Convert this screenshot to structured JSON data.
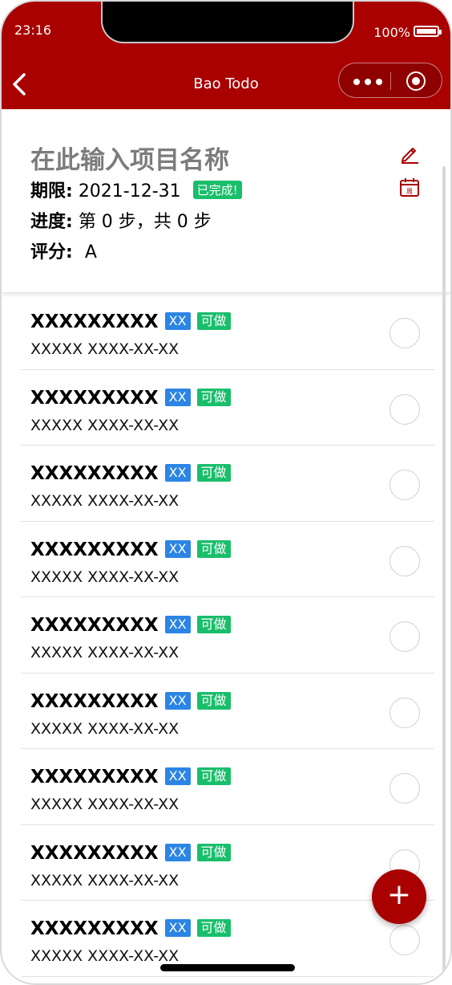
{
  "status": {
    "time": "23:16",
    "battery": "100%"
  },
  "nav": {
    "title": "Bao Todo"
  },
  "project": {
    "name": "在此输入项目名称",
    "deadline_label": "期限:",
    "deadline_value": "2021-12-31",
    "done_badge": "已完成!",
    "progress_label": "进度:",
    "progress_value": "第 0 步，共 0 步",
    "score_label": "评分:",
    "score_value": "A",
    "calendar_glyph": "周"
  },
  "tasks": [
    {
      "name": "XXXXXXXXX",
      "tag1": "XX",
      "tag2": "可做",
      "sub": "XXXXX  XXXX-XX-XX"
    },
    {
      "name": "XXXXXXXXX",
      "tag1": "XX",
      "tag2": "可做",
      "sub": "XXXXX  XXXX-XX-XX"
    },
    {
      "name": "XXXXXXXXX",
      "tag1": "XX",
      "tag2": "可做",
      "sub": "XXXXX  XXXX-XX-XX"
    },
    {
      "name": "XXXXXXXXX",
      "tag1": "XX",
      "tag2": "可做",
      "sub": "XXXXX  XXXX-XX-XX"
    },
    {
      "name": "XXXXXXXXX",
      "tag1": "XX",
      "tag2": "可做",
      "sub": "XXXXX  XXXX-XX-XX"
    },
    {
      "name": "XXXXXXXXX",
      "tag1": "XX",
      "tag2": "可做",
      "sub": "XXXXX  XXXX-XX-XX"
    },
    {
      "name": "XXXXXXXXX",
      "tag1": "XX",
      "tag2": "可做",
      "sub": "XXXXX  XXXX-XX-XX"
    },
    {
      "name": "XXXXXXXXX",
      "tag1": "XX",
      "tag2": "可做",
      "sub": "XXXXX  XXXX-XX-XX"
    },
    {
      "name": "XXXXXXXXX",
      "tag1": "XX",
      "tag2": "可做",
      "sub": "XXXXX  XXXX-XX-XX"
    }
  ],
  "fab": {
    "label": "+"
  },
  "colors": {
    "brand": "#a90000",
    "tag_blue": "#2b85e4",
    "tag_green": "#19be6b"
  }
}
